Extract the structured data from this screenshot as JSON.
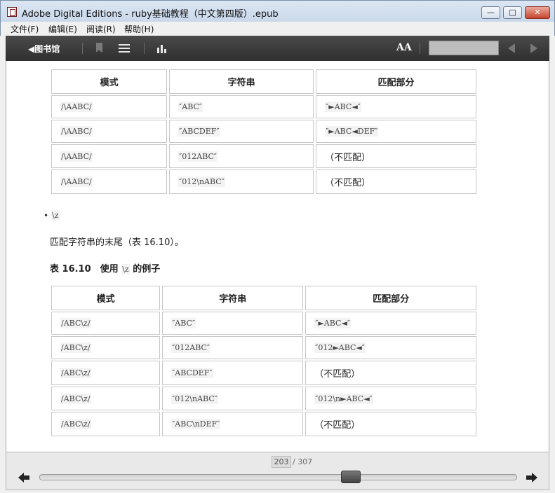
{
  "window": {
    "title": "Adobe Digital Editions - ruby基础教程（中文第四版）.epub",
    "min_glyph": "—",
    "max_glyph": "□",
    "close_glyph": "✕"
  },
  "menu": {
    "file": "文件(F)",
    "edit": "编辑(E)",
    "read": "阅读(R)",
    "help": "帮助(H)"
  },
  "toolbar": {
    "library_label": "◀图书馆",
    "font_label": "AA"
  },
  "table1": {
    "headers": [
      "模式",
      "字符串",
      "匹配部分"
    ],
    "rows": [
      [
        "/\\AABC/",
        "″ABC″",
        "″►ABC◄″"
      ],
      [
        "/\\AABC/",
        "″ABCDEF″",
        "″►ABC◄DEF″"
      ],
      [
        "/\\AABC/",
        "″012ABC″",
        "（不匹配）"
      ],
      [
        "/\\AABC/",
        "″012\\nABC″",
        "（不匹配）"
      ]
    ]
  },
  "bullet": {
    "mark": "•",
    "code": "\\z"
  },
  "paragraph": "匹配字符串的末尾（表 16.10）。",
  "caption": {
    "prefix": "表 16.10　使用",
    "code": "\\z",
    "suffix": "的例子"
  },
  "table2": {
    "headers": [
      "模式",
      "字符串",
      "匹配部分"
    ],
    "rows": [
      [
        "/ABC\\z/",
        "″ABC″",
        "″►ABC◄″"
      ],
      [
        "/ABC\\z/",
        "″012ABC″",
        "″012►ABC◄″"
      ],
      [
        "/ABC\\z/",
        "″ABCDEF″",
        "（不匹配）"
      ],
      [
        "/ABC\\z/",
        "″012\\nABC″",
        "″012\\n►ABC◄″"
      ],
      [
        "/ABC\\z/",
        "″ABC\\nDEF″",
        "（不匹配）"
      ]
    ]
  },
  "pager": {
    "current": "203",
    "total": "/ 307",
    "progress_fraction": 0.661
  },
  "colors": {
    "toolbar_bg": "#3a3a3a",
    "close_button": "#c7452f",
    "page_bg": "#ffffff"
  }
}
